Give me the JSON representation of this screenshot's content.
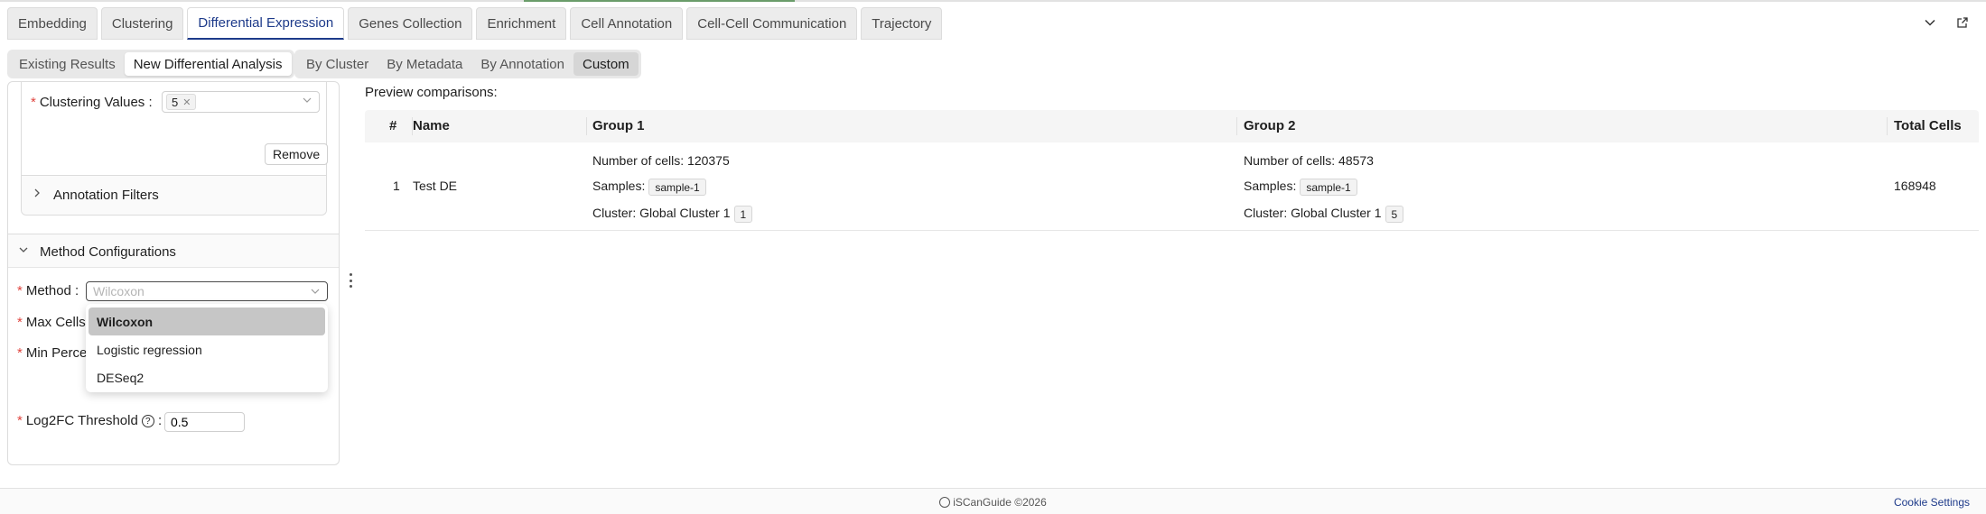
{
  "main_tabs": [
    "Embedding",
    "Clustering",
    "Differential Expression",
    "Genes Collection",
    "Enrichment",
    "Cell Annotation",
    "Cell-Cell Communication",
    "Trajectory"
  ],
  "active_main_tab": "Differential Expression",
  "mode_tabs": [
    "Existing Results",
    "New Differential Analysis"
  ],
  "active_mode_tab": "New Differential Analysis",
  "type_tabs": [
    "By Cluster",
    "By Metadata",
    "By Annotation",
    "Custom"
  ],
  "active_type_tab": "Custom",
  "filters": {
    "clustering_values_label": "Clustering Values",
    "clustering_value_tag": "5",
    "remove_label": "Remove",
    "annotation_filters_label": "Annotation Filters"
  },
  "method_config": {
    "section_label": "Method Configurations",
    "method_label": "Method",
    "method_placeholder": "Wilcoxon",
    "options": [
      "Wilcoxon",
      "Logistic regression",
      "DESeq2"
    ],
    "active_option": "Wilcoxon",
    "max_cells_label": "Max Cells",
    "min_percent_label": "Min Perce",
    "log2fc_label": "Log2FC Threshold",
    "log2fc_value": "0.5"
  },
  "preview": {
    "title": "Preview comparisons:",
    "columns": [
      "#",
      "Name",
      "Group 1",
      "Group 2",
      "Total Cells"
    ],
    "rows": [
      {
        "index": "1",
        "name": "Test DE",
        "group1": {
          "cells": "Number of cells: 120375",
          "samples_label": "Samples:",
          "sample": "sample-1",
          "cluster_label": "Cluster: Global Cluster 1",
          "cluster_chip": "1"
        },
        "group2": {
          "cells": "Number of cells: 48573",
          "samples_label": "Samples:",
          "sample": "sample-1",
          "cluster_label": "Cluster: Global Cluster 1",
          "cluster_chip": "5"
        },
        "total": "168948"
      }
    ]
  },
  "footer": {
    "copyright": "iSCanGuide ©2026",
    "cookie": "Cookie Settings"
  },
  "colors": {
    "accent": "#1d3a8a",
    "required": "#e0443e",
    "selected_option": "#c6c6c6"
  }
}
